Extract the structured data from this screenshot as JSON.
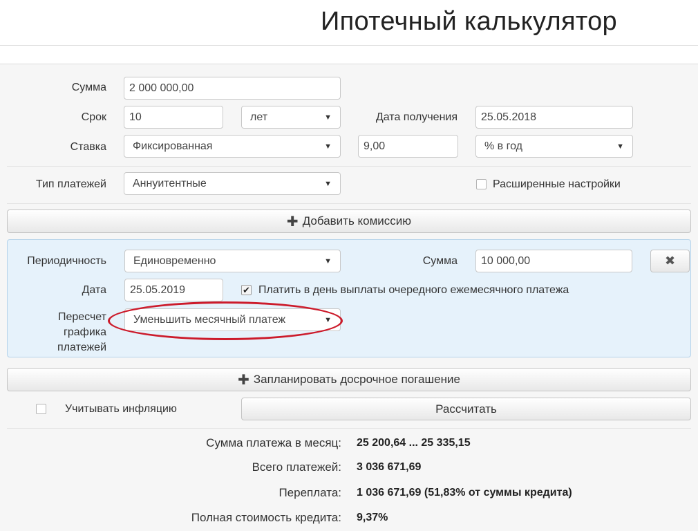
{
  "header": {
    "title": "Ипотечный калькулятор"
  },
  "form": {
    "sum": {
      "label": "Сумма",
      "value": "2 000 000,00"
    },
    "term": {
      "label": "Срок",
      "value": "10",
      "unit": "лет"
    },
    "receive_date": {
      "label": "Дата получения",
      "value": "25.05.2018"
    },
    "rate": {
      "label": "Ставка",
      "type": "Фиксированная",
      "value": "9,00",
      "unit": "% в год"
    },
    "payment_type": {
      "label": "Тип платежей",
      "value": "Аннуитентные"
    },
    "advanced": {
      "label": "Расширенные настройки",
      "checked": false
    }
  },
  "add_commission": {
    "icon": "plus-icon",
    "label": "Добавить комиссию"
  },
  "commission": {
    "periodicity": {
      "label": "Периодичность",
      "value": "Единовременно"
    },
    "sum": {
      "label": "Сумма",
      "value": "10 000,00"
    },
    "remove_icon": "close-icon",
    "date": {
      "label": "Дата",
      "value": "25.05.2019"
    },
    "pay_on_payment_day": {
      "label": "Платить в день выплаты очередного ежемесячного платежа",
      "checked": true
    },
    "recalc": {
      "label_line1": "Пересчет",
      "label_line2": "графика",
      "label_line3": "платежей",
      "value": "Уменьшить месячный платеж"
    },
    "highlight_color": "#cc1b2b"
  },
  "early_repayment": {
    "icon": "plus-icon",
    "label": "Запланировать досрочное погашение"
  },
  "inflation": {
    "label": "Учитывать инфляцию",
    "checked": false
  },
  "calculate": {
    "label": "Рассчитать"
  },
  "results": {
    "monthly": {
      "label": "Сумма платежа в месяц:",
      "value": "25 200,64 ... 25 335,15"
    },
    "total": {
      "label": "Всего платежей:",
      "value": "3 036 671,69"
    },
    "overpayment": {
      "label": "Переплата:",
      "value": "1 036 671,69 (51,83% от суммы кредита)"
    },
    "full_cost": {
      "label": "Полная стоимость кредита:",
      "value": "9,37%"
    }
  }
}
